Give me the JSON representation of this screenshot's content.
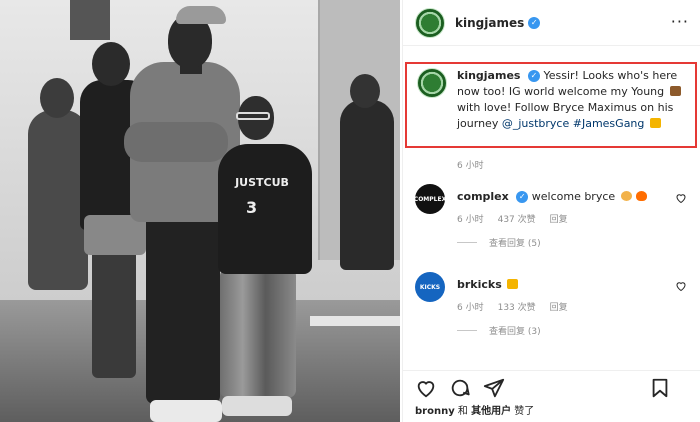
{
  "header": {
    "username": "kingjames",
    "more_label": "···"
  },
  "photo": {
    "hoodie_logo": "JUSTCUB",
    "jersey_number": "3"
  },
  "caption": {
    "username": "kingjames",
    "text_part1": "Yessir! Looks who's here now too! IG world welcome my Young",
    "text_part2": "with love! Follow Bryce Maximus on his journey",
    "mention": "@_justbryce",
    "hashtag": "#JamesGang",
    "time": "6 小时"
  },
  "comments": [
    {
      "username": "complex",
      "avatar_text": "COMPLEX",
      "avatar_color": "#111111",
      "text": "welcome bryce",
      "time": "6 小时",
      "likes": "437 次赞",
      "reply": "回复",
      "view_replies": "查看回复 (5)"
    },
    {
      "username": "brkicks",
      "avatar_text": "KICKS",
      "avatar_color": "#1565c0",
      "text": "",
      "time": "6 小时",
      "likes": "133 次赞",
      "reply": "回复",
      "view_replies": "查看回复 (3)"
    }
  ],
  "likes_line": {
    "user": "bronny",
    "and": "和",
    "others": "其他用户",
    "suffix": "赞了"
  },
  "colors": {
    "highlight_border": "#e53935",
    "verified": "#3897f0",
    "link": "#00376b"
  },
  "icons": [
    "more-options-icon",
    "heart-icon",
    "comment-icon",
    "share-icon",
    "bookmark-icon",
    "verified-badge-icon"
  ]
}
